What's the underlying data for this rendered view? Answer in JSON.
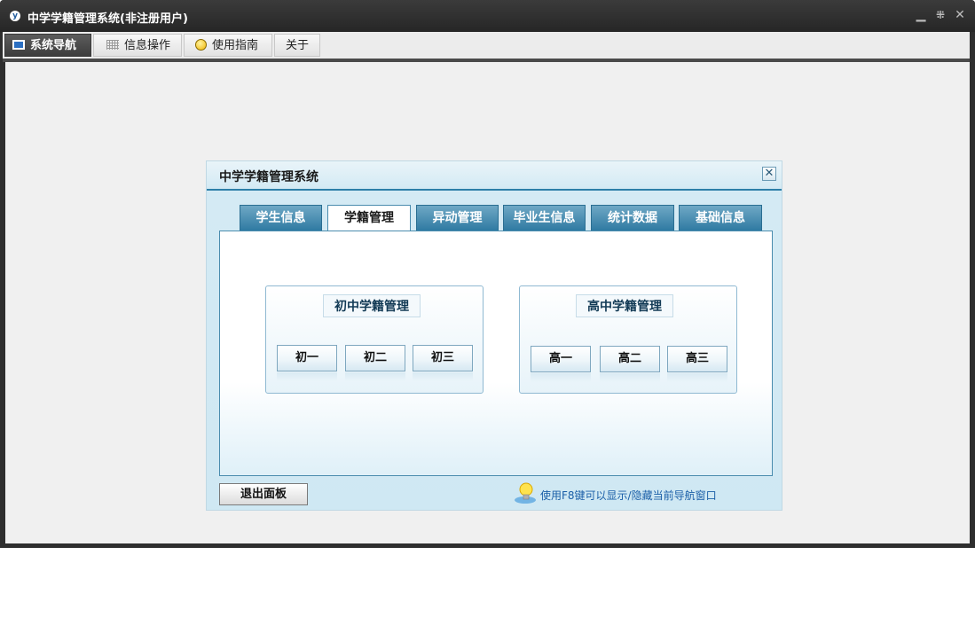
{
  "window": {
    "title": "中学学籍管理系统(非注册用户)",
    "app_icon": "y-logo-icon",
    "controls": {
      "minimize_icon": "minimize-icon",
      "restore_icon": "restore-icon",
      "close_icon": "close-icon"
    }
  },
  "menubar": {
    "items": [
      {
        "label": "系统导航",
        "icon": "monitor-icon",
        "active": true
      },
      {
        "label": "信息操作",
        "icon": "grid-icon",
        "active": false
      },
      {
        "label": "使用指南",
        "icon": "smiley-icon",
        "active": false
      },
      {
        "label": "关于",
        "icon": "",
        "active": false
      }
    ]
  },
  "dialog": {
    "title": "中学学籍管理系统",
    "close_icon": "close-icon",
    "tabs": [
      {
        "label": "学生信息",
        "active": false
      },
      {
        "label": "学籍管理",
        "active": true
      },
      {
        "label": "异动管理",
        "active": false
      },
      {
        "label": "毕业生信息",
        "active": false
      },
      {
        "label": "统计数据",
        "active": false
      },
      {
        "label": "基础信息",
        "active": false
      }
    ],
    "groups": [
      {
        "title": "初中学籍管理",
        "buttons": [
          "初一",
          "初二",
          "初三"
        ]
      },
      {
        "title": "高中学籍管理",
        "buttons": [
          "高一",
          "高二",
          "高三"
        ]
      }
    ],
    "exit_label": "退出面板",
    "hint_text": "使用F8键可以显示/隐藏当前导航窗口",
    "hint_icon": "lightbulb-icon"
  },
  "colors": {
    "titlebar": "#2e2e2e",
    "tab_blue": "#2f7aa2",
    "accent_line": "#2d7fa8",
    "hint_text": "#1b5fa8"
  }
}
